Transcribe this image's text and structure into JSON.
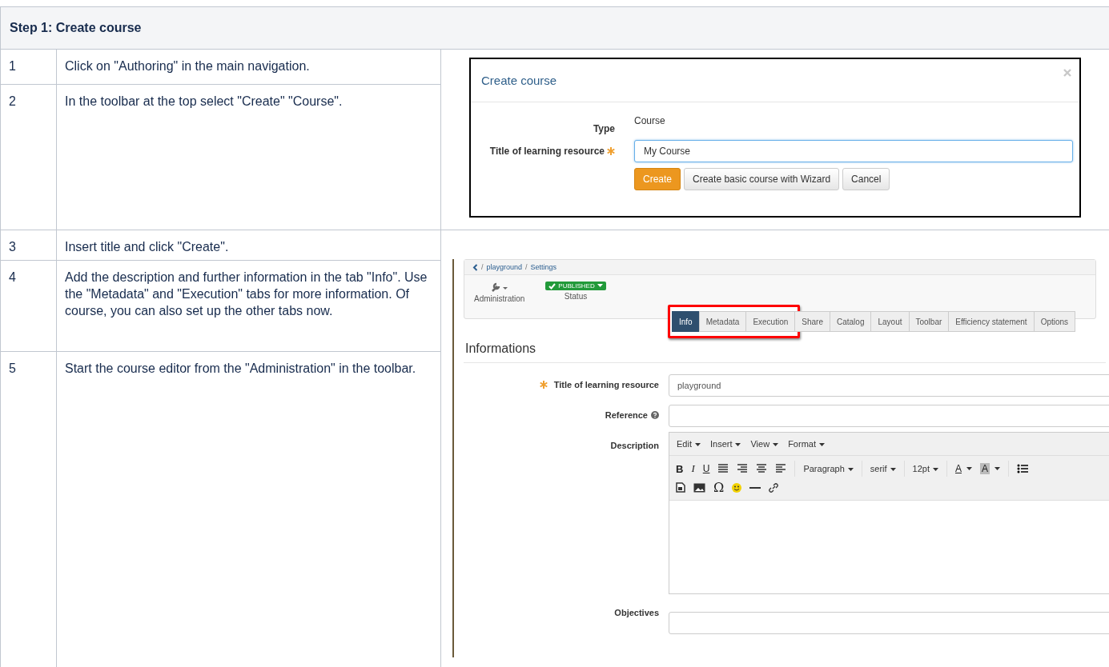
{
  "title": "Step 1: Create course",
  "steps": [
    {
      "number": "1",
      "text": "Click on \"Authoring\" in the main navigation."
    },
    {
      "number": "2",
      "text": "In the toolbar at the top select \"Create\"  \"Course\"."
    },
    {
      "number": "3",
      "text": "Insert title and click \"Create\"."
    },
    {
      "number": "4",
      "text": "Add the description and further information in the tab \"Info\". Use the \"Metadata\" and \"Execution\" tabs for more information. Of course, you can also set up the other tabs now."
    },
    {
      "number": "5",
      "text": "Start the course editor from the \"Administration\" in the toolbar."
    }
  ],
  "dialog": {
    "title": "Create course",
    "type_label": "Type",
    "type_value": "Course",
    "title_label": "Title of learning resource",
    "title_value": "My Course",
    "required": true,
    "buttons": [
      {
        "label": "Create",
        "kind": "primary"
      },
      {
        "label": "Create basic course with Wizard",
        "kind": "default"
      },
      {
        "label": "Cancel",
        "kind": "default"
      }
    ]
  },
  "settings": {
    "breadcrumb_separator": "/",
    "breadcrumb": [
      "playground",
      "Settings"
    ],
    "admin_label": "Administration",
    "status_badge": "PUBLISHED",
    "status_label": "Status",
    "tabs": [
      {
        "label": "Info",
        "selected": true,
        "highlighted": true
      },
      {
        "label": "Metadata",
        "selected": false,
        "highlighted": true
      },
      {
        "label": "Execution",
        "selected": false,
        "highlighted": true
      },
      {
        "label": "Share",
        "selected": false,
        "highlighted": false
      },
      {
        "label": "Catalog",
        "selected": false,
        "highlighted": false
      },
      {
        "label": "Layout",
        "selected": false,
        "highlighted": false
      },
      {
        "label": "Toolbar",
        "selected": false,
        "highlighted": false
      },
      {
        "label": "Efficiency statement",
        "selected": false,
        "highlighted": false
      },
      {
        "label": "Options",
        "selected": false,
        "highlighted": false
      }
    ],
    "section_title": "Informations",
    "fields": [
      {
        "label": "Title of learning resource",
        "value": "playground",
        "required": true,
        "kind": "input"
      },
      {
        "label": "Reference",
        "help": true,
        "kind": "input"
      },
      {
        "label": "Description",
        "kind": "editor"
      },
      {
        "label": "Objectives",
        "kind": "input"
      }
    ],
    "editor": {
      "menus": [
        "Edit",
        "Insert",
        "View",
        "Format"
      ],
      "format_buttons": [
        "B",
        "I",
        "U"
      ],
      "dropdowns": [
        "Paragraph",
        "serif",
        "12pt"
      ],
      "color_buttons": [
        "A",
        "A"
      ],
      "omega": "Ω"
    }
  }
}
